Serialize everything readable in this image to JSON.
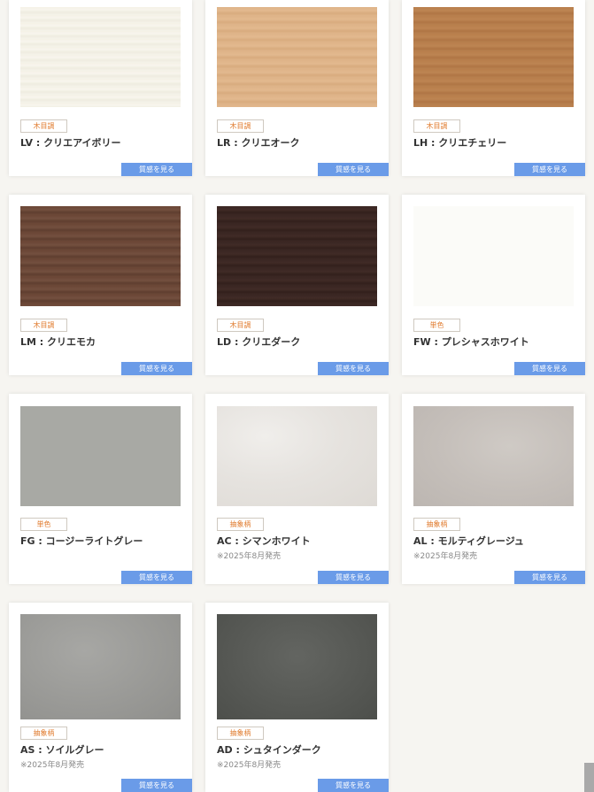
{
  "items": [
    {
      "tag": "木目調",
      "name": "LV : クリエアイボリー",
      "note": "",
      "button": "質感を見る",
      "swatch_color": "#f4f1e6"
    },
    {
      "tag": "木目調",
      "name": "LR : クリエオーク",
      "note": "",
      "button": "質感を見る",
      "swatch_color": "#deb388"
    },
    {
      "tag": "木目調",
      "name": "LH : クリエチェリー",
      "note": "",
      "button": "質感を見る",
      "swatch_color": "#b87e4c"
    },
    {
      "tag": "木目調",
      "name": "LM : クリエモカ",
      "note": "",
      "button": "質感を見る",
      "swatch_color": "#6b4636"
    },
    {
      "tag": "木目調",
      "name": "LD : クリエダーク",
      "note": "",
      "button": "質感を見る",
      "swatch_color": "#3a2622"
    },
    {
      "tag": "単色",
      "name": "FW : プレシャスホワイト",
      "note": "",
      "button": "質感を見る",
      "swatch_color": "#fbfbf8"
    },
    {
      "tag": "単色",
      "name": "FG : コージーライトグレー",
      "note": "",
      "button": "質感を見る",
      "swatch_color": "#a8a9a4"
    },
    {
      "tag": "抽象柄",
      "name": "AC : シマンホワイト",
      "note": "※2025年8月発売",
      "button": "質感を見る",
      "swatch_color": "#e6e3df"
    },
    {
      "tag": "抽象柄",
      "name": "AL : モルティグレージュ",
      "note": "※2025年8月発売",
      "button": "質感を見る",
      "swatch_color": "#c5bfba"
    },
    {
      "tag": "抽象柄",
      "name": "AS : ソイルグレー",
      "note": "※2025年8月発売",
      "button": "質感を見る",
      "swatch_color": "#9b9b98"
    },
    {
      "tag": "抽象柄",
      "name": "AD : シュタインダーク",
      "note": "※2025年8月発売",
      "button": "質感を見る",
      "swatch_color": "#575955"
    }
  ],
  "colors": {
    "tag_text": "#e07a2c",
    "button_bg": "#6a9be8",
    "page_bg": "#f6f5f1"
  }
}
